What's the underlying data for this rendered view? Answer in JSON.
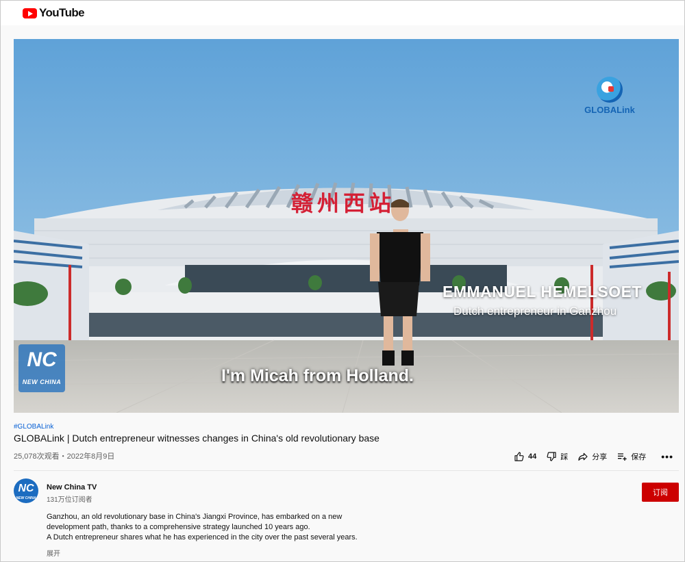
{
  "header": {
    "logo_text": "YouTube"
  },
  "video": {
    "station_sign": "赣州西站",
    "globalink_logo": "GLOBALink",
    "lower_third_name": "EMMANUEL HEMELSOET",
    "lower_third_role": "Dutch entrepreneur in Ganzhou",
    "subtitle": "I'm Micah from Holland.",
    "watermark_text": "NEW CHINA"
  },
  "info": {
    "hashtag": "#GLOBALink",
    "title": "GLOBALink | Dutch entrepreneur witnesses changes in China's old revolutionary base",
    "views_date": "25,078次观看・2022年8月9日",
    "likes": "44",
    "dislike_label": "踩",
    "share_label": "分享",
    "save_label": "保存",
    "more_label": "•••"
  },
  "channel": {
    "avatar_text": "NC",
    "name": "New China TV",
    "subscribers": "131万位订阅者",
    "subscribe_label": "订阅"
  },
  "description": {
    "line1": "Ganzhou, an old revolutionary base in China's Jiangxi Province, has embarked on a new",
    "line2": "development path, thanks to a comprehensive strategy launched 10 years ago.",
    "line3": "A Dutch entrepreneur shares what he has experienced in the city over the past several years.",
    "expand_label": "展开"
  },
  "colors": {
    "accent": "#cc0000",
    "link": "#065fd4",
    "brand_red": "#ff0000"
  }
}
